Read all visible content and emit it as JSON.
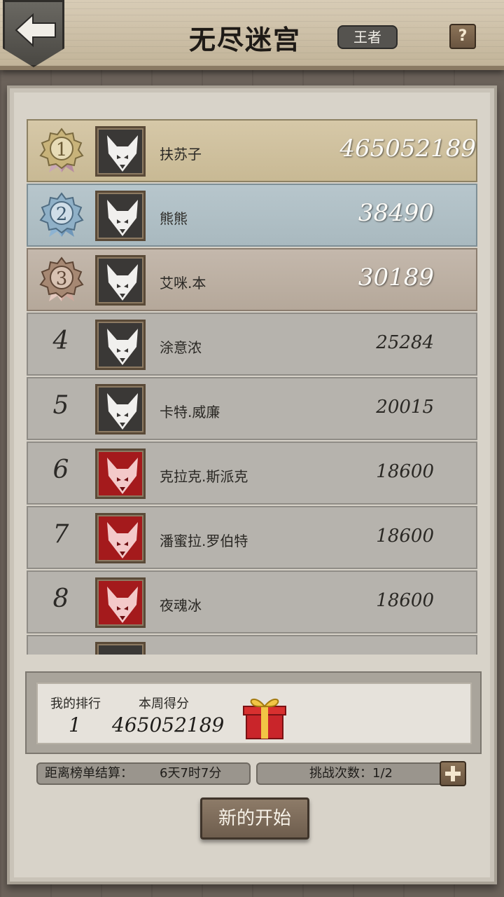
{
  "header": {
    "title": "无尽迷宫",
    "tier": "王者",
    "help_label": "?"
  },
  "leaderboard": [
    {
      "rank": "1",
      "name": "扶苏子",
      "score": "465052189",
      "avatar_color": "dark",
      "style": "gold"
    },
    {
      "rank": "2",
      "name": "熊熊",
      "score": "38490",
      "avatar_color": "dark",
      "style": "silver"
    },
    {
      "rank": "3",
      "name": "艾咪.本",
      "score": "30189",
      "avatar_color": "dark",
      "style": "bronze"
    },
    {
      "rank": "4",
      "name": "涂意浓",
      "score": "25284",
      "avatar_color": "dark",
      "style": "normal"
    },
    {
      "rank": "5",
      "name": "卡特.威廉",
      "score": "20015",
      "avatar_color": "dark",
      "style": "normal"
    },
    {
      "rank": "6",
      "name": "克拉克.斯派克",
      "score": "18600",
      "avatar_color": "red",
      "style": "normal"
    },
    {
      "rank": "7",
      "name": "潘蜜拉.罗伯特",
      "score": "18600",
      "avatar_color": "red",
      "style": "normal"
    },
    {
      "rank": "8",
      "name": "夜魂冰",
      "score": "18600",
      "avatar_color": "red",
      "style": "normal"
    }
  ],
  "my_stats": {
    "rank_label": "我的排行",
    "score_label": "本周得分",
    "rank_value": "1",
    "score_value": "465052189"
  },
  "footer": {
    "settle_label": "距离榜单结算：",
    "settle_time": "6天7时7分",
    "challenge_label": "挑战次数：1/2",
    "start_button": "新的开始"
  },
  "colors": {
    "gold_row": "#d6c8a8",
    "silver_row": "#b7c6cc",
    "bronze_row": "#c4b8ac",
    "normal_row": "#b6b3ad",
    "red_avatar": "#a41a1c"
  },
  "icons": [
    "back-arrow-icon",
    "help-icon",
    "medal-icon",
    "wolf-icon",
    "gift-icon",
    "plus-icon"
  ]
}
